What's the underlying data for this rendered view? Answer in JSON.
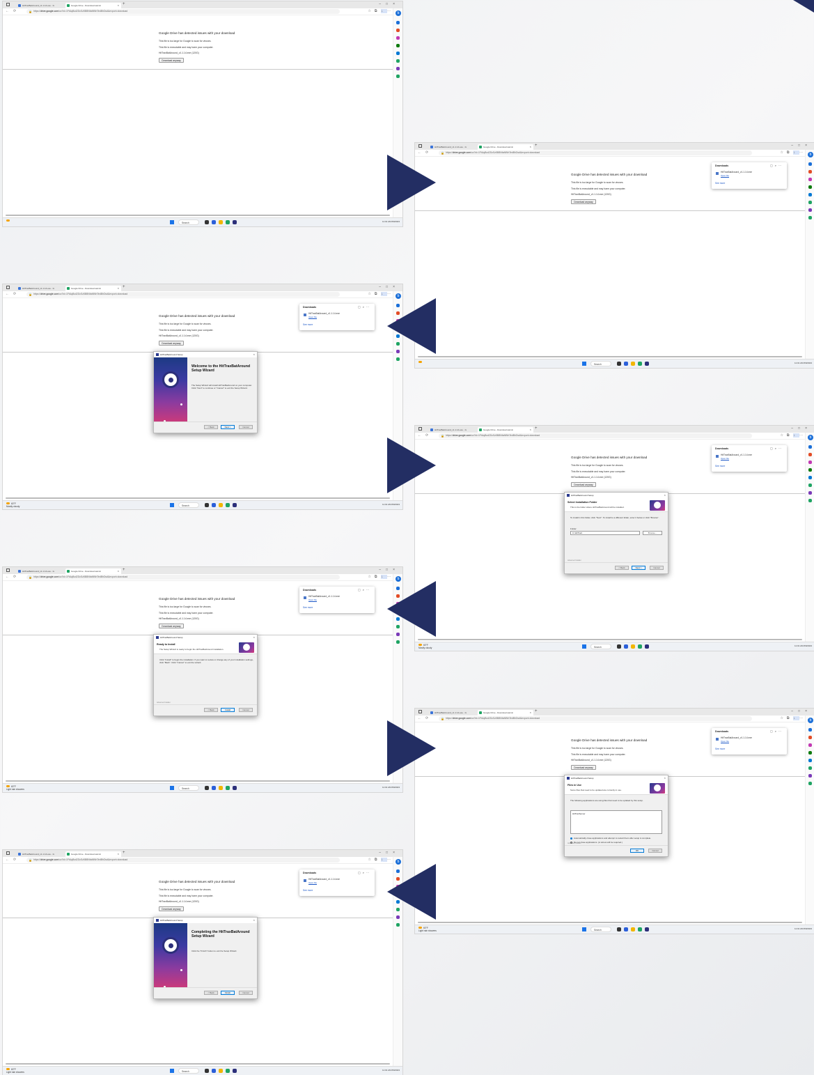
{
  "tabs": [
    {
      "label": "HitTraxBatAround_v1.1.14.exe - G"
    },
    {
      "label": "Google Drive - Download warnin"
    }
  ],
  "url": {
    "prefix": "https://",
    "host": "drive.google.com",
    "path": "/uc?id=1FtAqBcd2DcSz5BBNfaNfNhTedBhDsd&export=download"
  },
  "warning": {
    "title": "Google Drive has detected issues with your download",
    "line1": "This file is too large for Google to scan for viruses.",
    "line2": "This file is executable and may harm your computer.",
    "filename": "HitTraxBatAround_v1.1.14.exe",
    "size": " (120G)",
    "download_button": "Download anyway"
  },
  "downloads_panel": {
    "title": "Downloads",
    "file": "HitTraxBatAround_v1.1.14.exe",
    "open": "Open file",
    "see_more": "See more"
  },
  "taskbar": {
    "search": "Search",
    "time": "11:01 AM",
    "date": "8/9/2023"
  },
  "weather": [
    {
      "temp": "",
      "cond": ""
    },
    {
      "temp": "",
      "cond": ""
    },
    {
      "temp": "60°F",
      "cond": "Mostly cloudy"
    },
    {
      "temp": "60°F",
      "cond": "Mostly cloudy"
    },
    {
      "temp": "60°F",
      "cond": "Light rain showers"
    },
    {
      "temp": "60°F",
      "cond": "Light rain showers"
    },
    {
      "temp": "60°F",
      "cond": "Light rain showers"
    },
    {
      "temp": "Rainfall",
      "cond": "Coming"
    }
  ],
  "setup": {
    "window_title": "HitTraxBatAround Setup",
    "welcome_title": "Welcome to the HitTraxBatAround Setup Wizard",
    "welcome_desc": "The Setup Wizard will install HitTraxBatAround on your computer. Click \"Next\" to continue or \"Cancel\" to exit the Setup Wizard.",
    "folder_title": "Select Installation Folder",
    "folder_sub": "This is the folder where HitTraxBatAround will be installed.",
    "folder_desc": "To install in this folder, click \"Next\". To install to a different folder, enter it below or click \"Browse\".",
    "folder_label": "Folder:",
    "folder_value": "C:\\HitTrax\\",
    "browse": "Browse...",
    "ready_title": "Ready to Install",
    "ready_sub": "The Setup Wizard is ready to begin the HitTraxBatAround installation.",
    "ready_desc": "Click \"Install\" to begin the installation. If you want to review or change any of your installation settings, click \"Back\". Click \"Cancel\" to exit the wizard.",
    "inuse_title": "Files in Use",
    "inuse_sub": "Some files that need to be updated are currently in use.",
    "inuse_desc": "The following applications are using files that need to be updated by this setup.",
    "inuse_item": "HitTraxServer",
    "radio1": "Automatically close applications and attempt to restart them after setup is complete.",
    "radio2": "Do not close applications. (A reboot will be required.)",
    "complete_title": "Completing the HitTraxBatAround Setup Wizard",
    "complete_desc": "Click the \"Finish\" button to exit the Setup Wizard.",
    "back": "< Back",
    "next": "Next >",
    "install": "Install",
    "finish": "Finish",
    "cancel": "Cancel",
    "ok": "OK",
    "advanced": "Advanced Installer"
  },
  "colors": {
    "arrow": "#232e63",
    "link": "#1a56c7",
    "accent": "#0078d4"
  }
}
